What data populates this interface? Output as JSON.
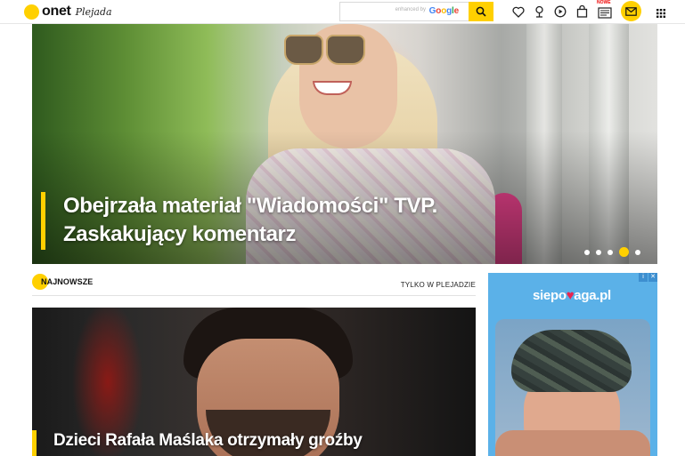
{
  "header": {
    "logo_text": "onet",
    "logo_sub": "Plejada",
    "search_placeholder": "",
    "powered_label": "enhanced by",
    "google_label": "Google",
    "new_badge": "NOWE"
  },
  "hero": {
    "title": "Obejrzała materiał \"Wiadomości\" TVP. Zaskakujący komentarz",
    "slides_total": 5,
    "active_slide": 4
  },
  "section": {
    "title": "NAJNOWSZE",
    "right_link": "TYLKO W PLEJADZIE"
  },
  "article": {
    "title": "Dzieci Rafała Maślaka otrzymały groźby"
  },
  "ad": {
    "logo_part1": "siepo",
    "logo_heart": "♥",
    "logo_part2": "aga.pl",
    "badge_info": "i",
    "badge_close": "✕"
  },
  "colors": {
    "accent": "#ffd000",
    "ad_background": "#5bb1e8"
  },
  "icons": [
    "heart-icon",
    "horoscope-icon",
    "play-icon",
    "shopping-bag-icon",
    "tv-program-icon",
    "mail-icon",
    "apps-grid-icon",
    "search-icon"
  ]
}
